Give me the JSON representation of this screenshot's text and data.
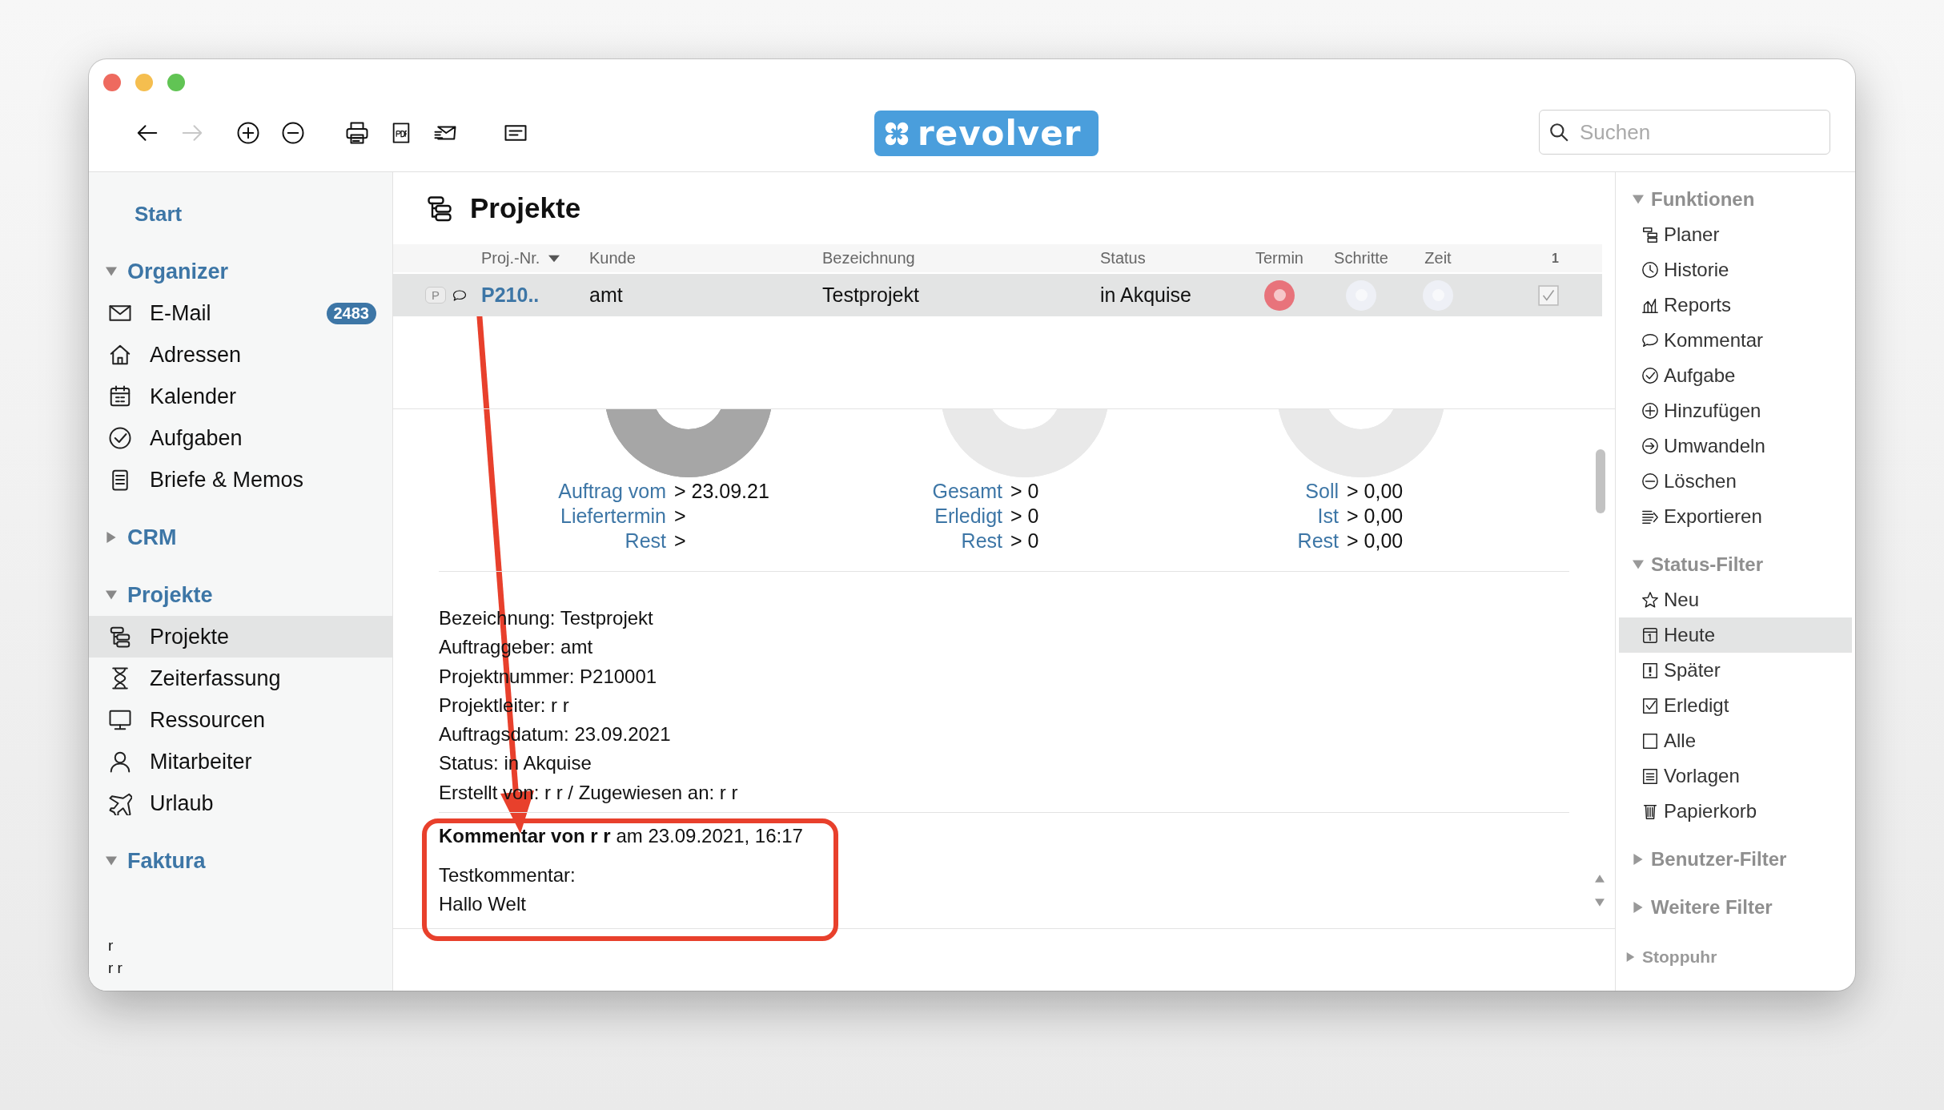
{
  "window": {
    "logo": "revolver",
    "search": {
      "placeholder": "Suchen"
    },
    "toolbar": [
      {
        "disabled": false
      },
      {
        "disabled": true
      },
      {
        "disabled": false
      },
      {
        "disabled": false
      },
      {
        "disabled": false
      },
      {
        "disabled": false
      },
      {
        "disabled": false
      },
      {
        "disabled": false
      }
    ]
  },
  "sidebar": {
    "start": "Start",
    "sections": [
      {
        "title": "Organizer",
        "expanded": true,
        "items": [
          {
            "label": "E-Mail",
            "badge": "2483",
            "selected": false
          },
          {
            "label": "Adressen",
            "selected": false
          },
          {
            "label": "Kalender",
            "selected": false
          },
          {
            "label": "Aufgaben",
            "selected": false
          },
          {
            "label": "Briefe & Memos",
            "selected": false
          }
        ]
      },
      {
        "title": "CRM",
        "expanded": false
      },
      {
        "title": "Projekte",
        "expanded": true,
        "items": [
          {
            "label": "Projekte",
            "selected": true
          },
          {
            "label": "Zeiterfassung",
            "selected": false
          },
          {
            "label": "Ressourcen",
            "selected": false
          },
          {
            "label": "Mitarbeiter",
            "selected": false
          },
          {
            "label": "Urlaub",
            "selected": false
          }
        ]
      },
      {
        "title": "Faktura",
        "expanded": true
      }
    ],
    "footer": [
      "r",
      "r r"
    ]
  },
  "main": {
    "title": "Projekte",
    "table": {
      "columns": [
        {
          "label": "Proj.-Nr.",
          "sorted": true
        },
        {
          "label": "Kunde",
          "sorted": false
        },
        {
          "label": "Bezeichnung",
          "sorted": false
        },
        {
          "label": "Status",
          "sorted": false
        },
        {
          "label": "Termin",
          "sorted": false
        },
        {
          "label": "Schritte",
          "sorted": false
        },
        {
          "label": "Zeit",
          "sorted": false
        },
        {
          "label": "1",
          "sorted": false
        }
      ],
      "rows": [
        {
          "tag": "P",
          "number": "P210..",
          "customer": "amt",
          "title": "Testprojekt",
          "status": "in Akquise",
          "indicators": [
            {
              "color": "#e8737b"
            },
            {
              "color": "#eef0f6"
            },
            {
              "color": "#eef0f6"
            }
          ],
          "checked": true,
          "selected": true
        }
      ]
    },
    "summary": [
      {
        "filled": true,
        "lines": [
          {
            "label": "Auftrag vom",
            "value": "> 23.09.21"
          },
          {
            "label": "Liefertermin",
            "value": ">"
          },
          {
            "label": "Rest",
            "value": ">"
          }
        ]
      },
      {
        "filled": false,
        "lines": [
          {
            "label": "Gesamt",
            "value": "> 0"
          },
          {
            "label": "Erledigt",
            "value": "> 0"
          },
          {
            "label": "Rest",
            "value": "> 0"
          }
        ]
      },
      {
        "filled": false,
        "lines": [
          {
            "label": "Soll",
            "value": "> 0,00"
          },
          {
            "label": "Ist",
            "value": "> 0,00"
          },
          {
            "label": "Rest",
            "value": "> 0,00"
          }
        ]
      }
    ],
    "details": [
      "Bezeichnung: Testprojekt",
      "Auftraggeber: amt",
      "Projektnummer: P210001",
      "Projektleiter: r r",
      "Auftragsdatum: 23.09.2021",
      "Status: in Akquise",
      "Erstellt von: r r / Zugewiesen an: r r"
    ],
    "comment": {
      "header": "**Kommentar von r r** am 23.09.2021, 16:17",
      "lines": [
        "Testkommentar:",
        "Hallo Welt"
      ]
    }
  },
  "panel": {
    "sections": [
      {
        "title": "Funktionen",
        "expanded": true,
        "items": [
          {
            "label": "Planer",
            "selected": false
          },
          {
            "label": "Historie",
            "selected": false
          },
          {
            "label": "Reports",
            "selected": false
          },
          {
            "label": "Kommentar",
            "selected": false
          },
          {
            "label": "Aufgabe",
            "selected": false
          },
          {
            "label": "Hinzufügen",
            "selected": false
          },
          {
            "label": "Umwandeln",
            "selected": false
          },
          {
            "label": "Löschen",
            "selected": false
          },
          {
            "label": "Exportieren",
            "selected": false
          }
        ]
      },
      {
        "title": "Status-Filter",
        "expanded": true,
        "items": [
          {
            "label": "Neu",
            "selected": false
          },
          {
            "label": "Heute",
            "selected": true
          },
          {
            "label": "Später",
            "selected": false
          },
          {
            "label": "Erledigt",
            "selected": false
          },
          {
            "label": "Alle",
            "selected": false
          },
          {
            "label": "Vorlagen",
            "selected": false
          },
          {
            "label": "Papierkorb",
            "selected": false
          }
        ]
      },
      {
        "title": "Benutzer-Filter",
        "expanded": false
      },
      {
        "title": "Weitere Filter",
        "expanded": false
      }
    ],
    "stopwatch": {
      "title": "Stoppuhr",
      "expanded": false
    }
  }
}
